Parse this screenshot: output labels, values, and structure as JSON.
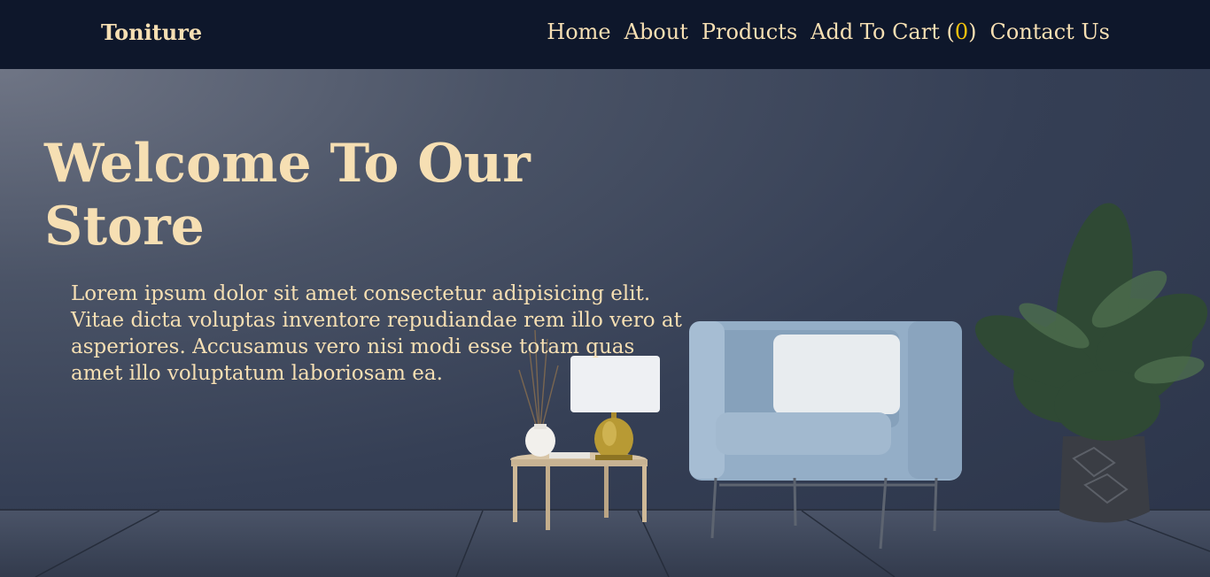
{
  "navbar": {
    "brand": "Toniture",
    "links": [
      {
        "label": "Home"
      },
      {
        "label": "About"
      },
      {
        "label": "Products"
      },
      {
        "label_prefix": "Add To Cart (",
        "count": "0",
        "label_suffix": ")"
      },
      {
        "label": "Contact Us"
      }
    ]
  },
  "hero": {
    "title": "Welcome To Our Store",
    "description": "Lorem ipsum dolor sit amet consectetur adipisicing elit. Vitae dicta voluptas inventore repudiandae rem illo vero at asperiores. Accusamus vero nisi modi esse totam quas amet illo voluptatum laboriosam ea."
  },
  "colors": {
    "navbar_bg": "#0e172b",
    "text_accent": "#f6dfb3",
    "cart_count": "#f4c20d",
    "hero_bg": "#353f55"
  }
}
